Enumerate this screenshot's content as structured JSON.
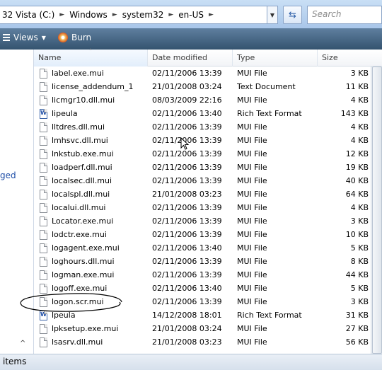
{
  "address": {
    "breadcrumbs": [
      "32 Vista (C:)",
      "Windows",
      "system32",
      "en-US"
    ],
    "search_placeholder": "Search"
  },
  "toolbar": {
    "views_label": "Views",
    "burn_label": "Burn"
  },
  "nav_pane": {
    "partial_label": "ged"
  },
  "columns": {
    "name": "Name",
    "date": "Date modified",
    "type": "Type",
    "size": "Size"
  },
  "files": [
    {
      "name": "label.exe.mui",
      "date": "02/11/2006 13:39",
      "type": "MUI File",
      "size": "3 KB",
      "icon": "file-icon"
    },
    {
      "name": "license_addendum_1",
      "date": "21/01/2008 03:24",
      "type": "Text Document",
      "size": "11 KB",
      "icon": "file-icon"
    },
    {
      "name": "licmgr10.dll.mui",
      "date": "08/03/2009 22:16",
      "type": "MUI File",
      "size": "4 KB",
      "icon": "file-icon"
    },
    {
      "name": "lipeula",
      "date": "02/11/2006 13:40",
      "type": "Rich Text Format",
      "size": "143 KB",
      "icon": "rtf-icon"
    },
    {
      "name": "lltdres.dll.mui",
      "date": "02/11/2006 13:39",
      "type": "MUI File",
      "size": "4 KB",
      "icon": "file-icon"
    },
    {
      "name": "lmhsvc.dll.mui",
      "date": "02/11/2006 13:39",
      "type": "MUI File",
      "size": "4 KB",
      "icon": "file-icon"
    },
    {
      "name": "lnkstub.exe.mui",
      "date": "02/11/2006 13:39",
      "type": "MUI File",
      "size": "12 KB",
      "icon": "file-icon"
    },
    {
      "name": "loadperf.dll.mui",
      "date": "02/11/2006 13:39",
      "type": "MUI File",
      "size": "19 KB",
      "icon": "file-icon"
    },
    {
      "name": "localsec.dll.mui",
      "date": "02/11/2006 13:39",
      "type": "MUI File",
      "size": "40 KB",
      "icon": "file-icon"
    },
    {
      "name": "localspl.dll.mui",
      "date": "21/01/2008 03:23",
      "type": "MUI File",
      "size": "64 KB",
      "icon": "file-icon"
    },
    {
      "name": "localui.dll.mui",
      "date": "02/11/2006 13:39",
      "type": "MUI File",
      "size": "4 KB",
      "icon": "file-icon"
    },
    {
      "name": "Locator.exe.mui",
      "date": "02/11/2006 13:39",
      "type": "MUI File",
      "size": "3 KB",
      "icon": "file-icon"
    },
    {
      "name": "lodctr.exe.mui",
      "date": "02/11/2006 13:39",
      "type": "MUI File",
      "size": "10 KB",
      "icon": "file-icon"
    },
    {
      "name": "logagent.exe.mui",
      "date": "02/11/2006 13:40",
      "type": "MUI File",
      "size": "5 KB",
      "icon": "file-icon"
    },
    {
      "name": "loghours.dll.mui",
      "date": "02/11/2006 13:39",
      "type": "MUI File",
      "size": "8 KB",
      "icon": "file-icon"
    },
    {
      "name": "logman.exe.mui",
      "date": "02/11/2006 13:39",
      "type": "MUI File",
      "size": "44 KB",
      "icon": "file-icon"
    },
    {
      "name": "logoff.exe.mui",
      "date": "02/11/2006 13:40",
      "type": "MUI File",
      "size": "5 KB",
      "icon": "file-icon"
    },
    {
      "name": "logon.scr.mui",
      "date": "02/11/2006 13:39",
      "type": "MUI File",
      "size": "3 KB",
      "icon": "file-icon"
    },
    {
      "name": "lpeula",
      "date": "14/12/2008 18:01",
      "type": "Rich Text Format",
      "size": "31 KB",
      "icon": "rtf-icon"
    },
    {
      "name": "lpksetup.exe.mui",
      "date": "21/01/2008 03:24",
      "type": "MUI File",
      "size": "27 KB",
      "icon": "file-icon"
    },
    {
      "name": "lsasrv.dll.mui",
      "date": "21/01/2008 03:23",
      "type": "MUI File",
      "size": "56 KB",
      "icon": "file-icon"
    }
  ],
  "status": {
    "text": "items"
  }
}
